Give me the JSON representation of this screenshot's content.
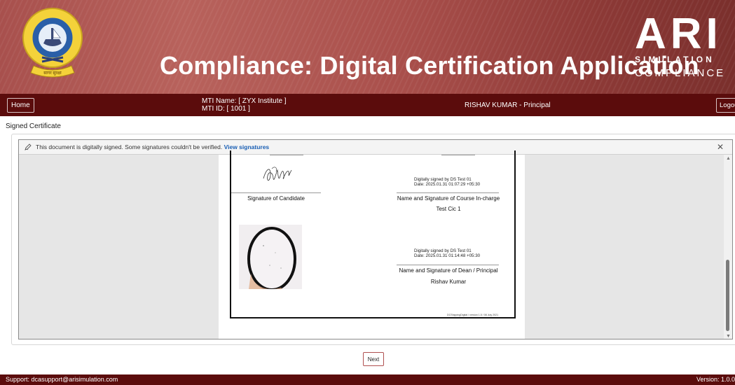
{
  "header": {
    "title": "Compliance: Digital Certification Application",
    "logo_text": "ARI",
    "logo_sub1": "SIMULATION",
    "logo_sub2": "COMPLIANCE",
    "emblem_ribbon": "सागर सुरक्षा"
  },
  "nav": {
    "home_label": "Home",
    "mti_name": "MTI Name: [ ZYX Institute ]",
    "mti_id": "MTI ID: [ 1001 ]",
    "user": "RISHAV KUMAR - Principal",
    "logout_label": "Logout"
  },
  "section_title": "Signed Certificate",
  "viewer": {
    "sig_notice": "This document is digitally signed. Some signatures couldn't be verified.",
    "sig_link": "View signatures",
    "close_glyph": "✕"
  },
  "document": {
    "candidate_caption": "Signature of Candidate",
    "ds1_line1": "Digitally signed by DS Test 01",
    "ds1_line2": "Date: 2025.01.31 01:07:29 +05:30",
    "course_caption": "Name and Signature of Course In-charge",
    "course_name": "Test Cic 1",
    "ds2_line1": "Digitally signed by DS Test 01",
    "ds2_line2": "Date: 2025.01.31 01:14:48 +05:30",
    "dean_caption": "Name and Signature of Dean / Principal",
    "dean_name": "Rishav Kumar",
    "footer_version": "DCShippingDigital / version 1.5 / 08 July 2021"
  },
  "actions": {
    "next_label": "Next"
  },
  "footer": {
    "support": "Support: dcasupport@arisimulation.com",
    "version": "Version: 1.0.0"
  },
  "colors": {
    "banner": "#a8504d",
    "nav": "#5b0c0c",
    "link": "#1a5fb4"
  }
}
